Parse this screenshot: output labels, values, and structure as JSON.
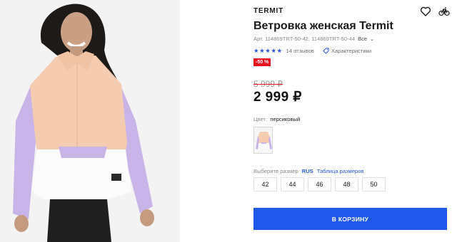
{
  "product": {
    "brand": "TERMIT",
    "title": "Ветровка женская Termit",
    "article": "Арт. 114869TRT-50-42, 114869TRT-50-44",
    "all_link": "Все",
    "rating": 5,
    "reviews": "14 отзывов",
    "specs_link": "Характеристики",
    "discount": "-50 %",
    "old_price": "5 999 ₽",
    "price": "2 999 ₽",
    "color_label": "Цвет:",
    "color_value": "персиковый",
    "size_label": "Выберите размер",
    "size_system": "RUS",
    "size_table_link": "Таблица размеров",
    "sizes": [
      "42",
      "44",
      "46",
      "48",
      "50"
    ],
    "cart_button": "В КОРЗИНУ"
  },
  "icons": {
    "favorite": "heart-icon",
    "compare": "bicycle-icon",
    "specs": "tag-icon",
    "all_chevron": "chevron-down-icon"
  },
  "colors": {
    "accent_blue": "#1f57e8",
    "star_blue": "#2c56d8",
    "discount_red": "#e8121f",
    "jacket_peach": "#f5cdb3",
    "jacket_lavender": "#c9b6e8"
  }
}
